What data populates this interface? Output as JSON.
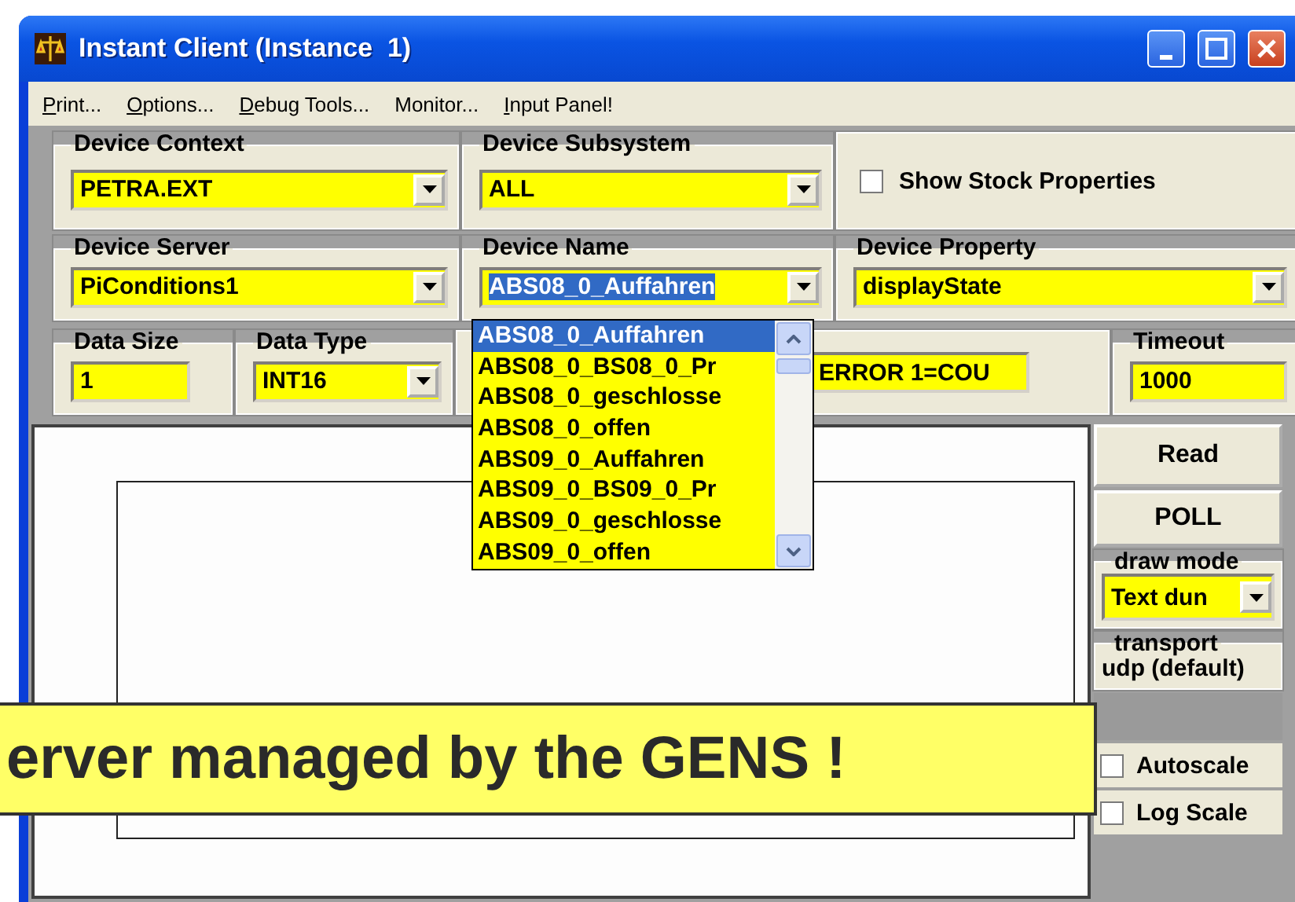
{
  "window": {
    "title": "Instant Client (Instance  1)"
  },
  "menu": [
    {
      "label": "Print...",
      "underlined_first": true
    },
    {
      "label": "Options...",
      "underlined_first": true
    },
    {
      "label": "Debug Tools...",
      "underlined_first": true
    },
    {
      "label": "Monitor...",
      "underlined_first": false
    },
    {
      "label": "Input Panel!",
      "underlined_first": true
    }
  ],
  "device_context": {
    "label": "Device Context",
    "value": "PETRA.EXT"
  },
  "device_subsystem": {
    "label": "Device Subsystem",
    "value": "ALL"
  },
  "show_stock_properties": {
    "label": "Show Stock Properties",
    "checked": false
  },
  "device_server": {
    "label": "Device Server",
    "value": "PiConditions1"
  },
  "device_name": {
    "label": "Device Name",
    "value": "ABS08_0_Auffahren",
    "highlighted": true
  },
  "device_property": {
    "label": "Device Property",
    "value": "displayState"
  },
  "data_size": {
    "label": "Data Size",
    "value": "1"
  },
  "data_type": {
    "label": "Data Type",
    "value": "INT16"
  },
  "data_value": {
    "value": "ERROR 1=COU"
  },
  "timeout": {
    "label": "Timeout",
    "value": "1000"
  },
  "device_name_list": [
    {
      "label": "ABS08_0_Auffahren",
      "selected": true
    },
    {
      "label": "ABS08_0_BS08_0_Pr",
      "selected": false
    },
    {
      "label": "ABS08_0_geschlosse",
      "selected": false
    },
    {
      "label": "ABS08_0_offen",
      "selected": false
    },
    {
      "label": "ABS09_0_Auffahren",
      "selected": false
    },
    {
      "label": "ABS09_0_BS09_0_Pr",
      "selected": false
    },
    {
      "label": "ABS09_0_geschlosse",
      "selected": false
    },
    {
      "label": "ABS09_0_offen",
      "selected": false
    }
  ],
  "buttons": [
    "Read",
    "POLL"
  ],
  "draw_mode": {
    "label": "draw mode",
    "value": "Text dun"
  },
  "transport": {
    "label": "transport",
    "value": "udp (default)"
  },
  "autoscale": {
    "label": "Autoscale",
    "checked": false
  },
  "log_scale": {
    "label": "Log Scale",
    "checked": false
  },
  "callout": {
    "text": "erver managed by the GENS !"
  }
}
